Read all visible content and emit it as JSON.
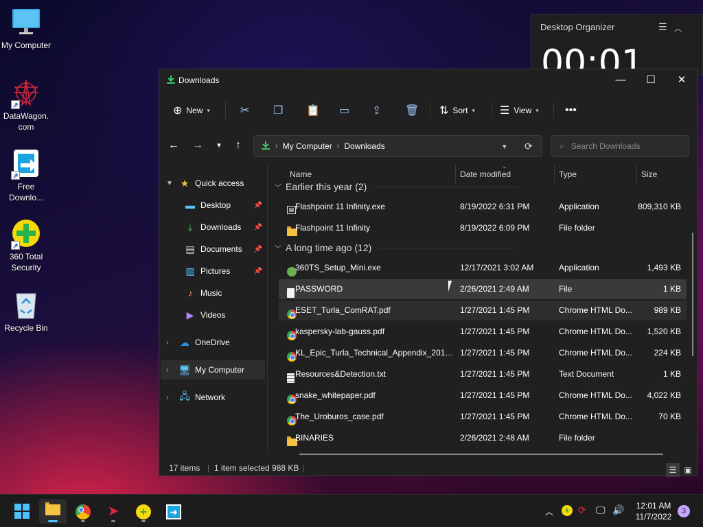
{
  "desktop": {
    "icons": [
      {
        "label": "My Computer"
      },
      {
        "label": "DataWagon. com"
      },
      {
        "label": "Free Downlo..."
      },
      {
        "label": "360 Total Security"
      },
      {
        "label": "Recycle Bin"
      }
    ]
  },
  "organizer": {
    "title": "Desktop Organizer",
    "clock": "00:01"
  },
  "window": {
    "title": "Downloads",
    "commands": {
      "new": "New",
      "sort": "Sort",
      "view": "View"
    },
    "address": {
      "crumbs": [
        "My Computer",
        "Downloads"
      ]
    },
    "search": {
      "placeholder": "Search Downloads"
    },
    "nav": {
      "quick_access": "Quick access",
      "desktop": "Desktop",
      "downloads": "Downloads",
      "documents": "Documents",
      "pictures": "Pictures",
      "music": "Music",
      "videos": "Videos",
      "onedrive": "OneDrive",
      "my_computer": "My Computer",
      "network": "Network"
    },
    "columns": {
      "name": "Name",
      "date": "Date modified",
      "type": "Type",
      "size": "Size"
    },
    "groups": [
      {
        "label": "Earlier this year (2)"
      },
      {
        "label": "A long time ago (12)"
      }
    ],
    "files": [
      {
        "name": "Flashpoint 11 Infinity.exe",
        "date": "8/19/2022 6:31 PM",
        "type": "Application",
        "size": "809,310 KB",
        "icon": "exe-icon"
      },
      {
        "name": "Flashpoint 11 Infinity",
        "date": "8/19/2022 6:09 PM",
        "type": "File folder",
        "size": "",
        "icon": "folder-icon"
      },
      {
        "name": "360TS_Setup_Mini.exe",
        "date": "12/17/2021 3:02 AM",
        "type": "Application",
        "size": "1,493 KB",
        "icon": "installer-icon"
      },
      {
        "name": "PASSWORD",
        "date": "2/26/2021 2:49 AM",
        "type": "File",
        "size": "1 KB",
        "icon": "file-icon"
      },
      {
        "name": "ESET_Turla_ComRAT.pdf",
        "date": "1/27/2021 1:45 PM",
        "type": "Chrome HTML Do...",
        "size": "989 KB",
        "icon": "chrome-icon"
      },
      {
        "name": "kaspersky-lab-gauss.pdf",
        "date": "1/27/2021 1:45 PM",
        "type": "Chrome HTML Do...",
        "size": "1,520 KB",
        "icon": "chrome-icon"
      },
      {
        "name": "KL_Epic_Turla_Technical_Appendix_20140...",
        "date": "1/27/2021 1:45 PM",
        "type": "Chrome HTML Do...",
        "size": "224 KB",
        "icon": "chrome-icon"
      },
      {
        "name": "Resources&Detection.txt",
        "date": "1/27/2021 1:45 PM",
        "type": "Text Document",
        "size": "1 KB",
        "icon": "text-file-icon"
      },
      {
        "name": "snake_whitepaper.pdf",
        "date": "1/27/2021 1:45 PM",
        "type": "Chrome HTML Do...",
        "size": "4,022 KB",
        "icon": "chrome-icon"
      },
      {
        "name": "The_Uroburos_case.pdf",
        "date": "1/27/2021 1:45 PM",
        "type": "Chrome HTML Do...",
        "size": "70 KB",
        "icon": "chrome-icon"
      },
      {
        "name": "BINARIES",
        "date": "2/26/2021 2:48 AM",
        "type": "File folder",
        "size": "",
        "icon": "folder-icon"
      }
    ],
    "status": {
      "items": "17 items",
      "selected": "1 item selected  988 KB"
    }
  },
  "taskbar": {
    "time": "12:01 AM",
    "date": "11/7/2022",
    "notifications": "3"
  },
  "colors": {
    "accent": "#4cc2ff",
    "window_bg": "#202020",
    "selection": "#3a3a3a"
  }
}
